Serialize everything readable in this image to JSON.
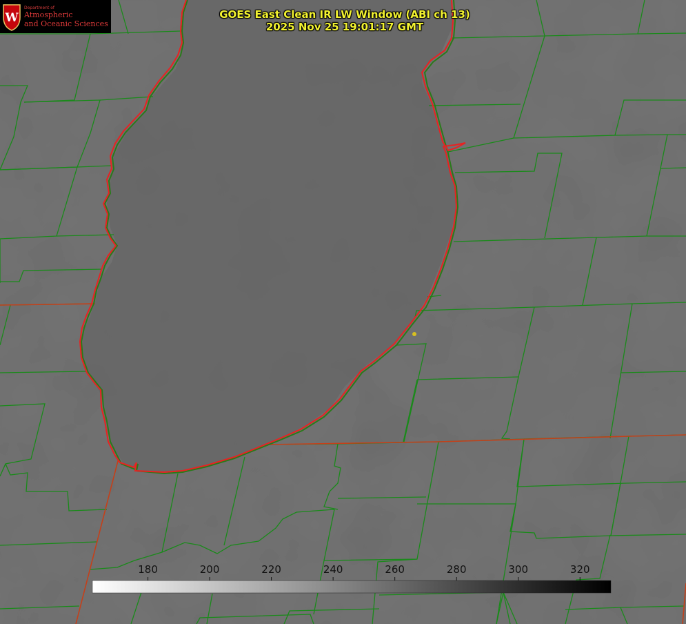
{
  "logo": {
    "department_label": "Department of",
    "line1": "Atmospheric",
    "line2": "and Oceanic Sciences",
    "shield_letter": "W"
  },
  "title": {
    "line1": "GOES East Clean IR LW Window (ABI ch 13)",
    "line2": "2025 Nov 25 19:01:17 GMT"
  },
  "colorbar": {
    "tick_labels": [
      "180",
      "200",
      "220",
      "240",
      "260",
      "280",
      "300",
      "320"
    ],
    "range": [
      162,
      330
    ],
    "gradient": "white to black"
  },
  "colors": {
    "background_gray": "#6e6e6e",
    "county_lines": "#1a8a1a",
    "lake_shoreline": "#e82222",
    "state_border": "#c83a1a",
    "title_text": "#f2f230",
    "marker": "#d8c020"
  },
  "map": {
    "feature": "lake-shoreline",
    "marker": "yellow-dot"
  }
}
